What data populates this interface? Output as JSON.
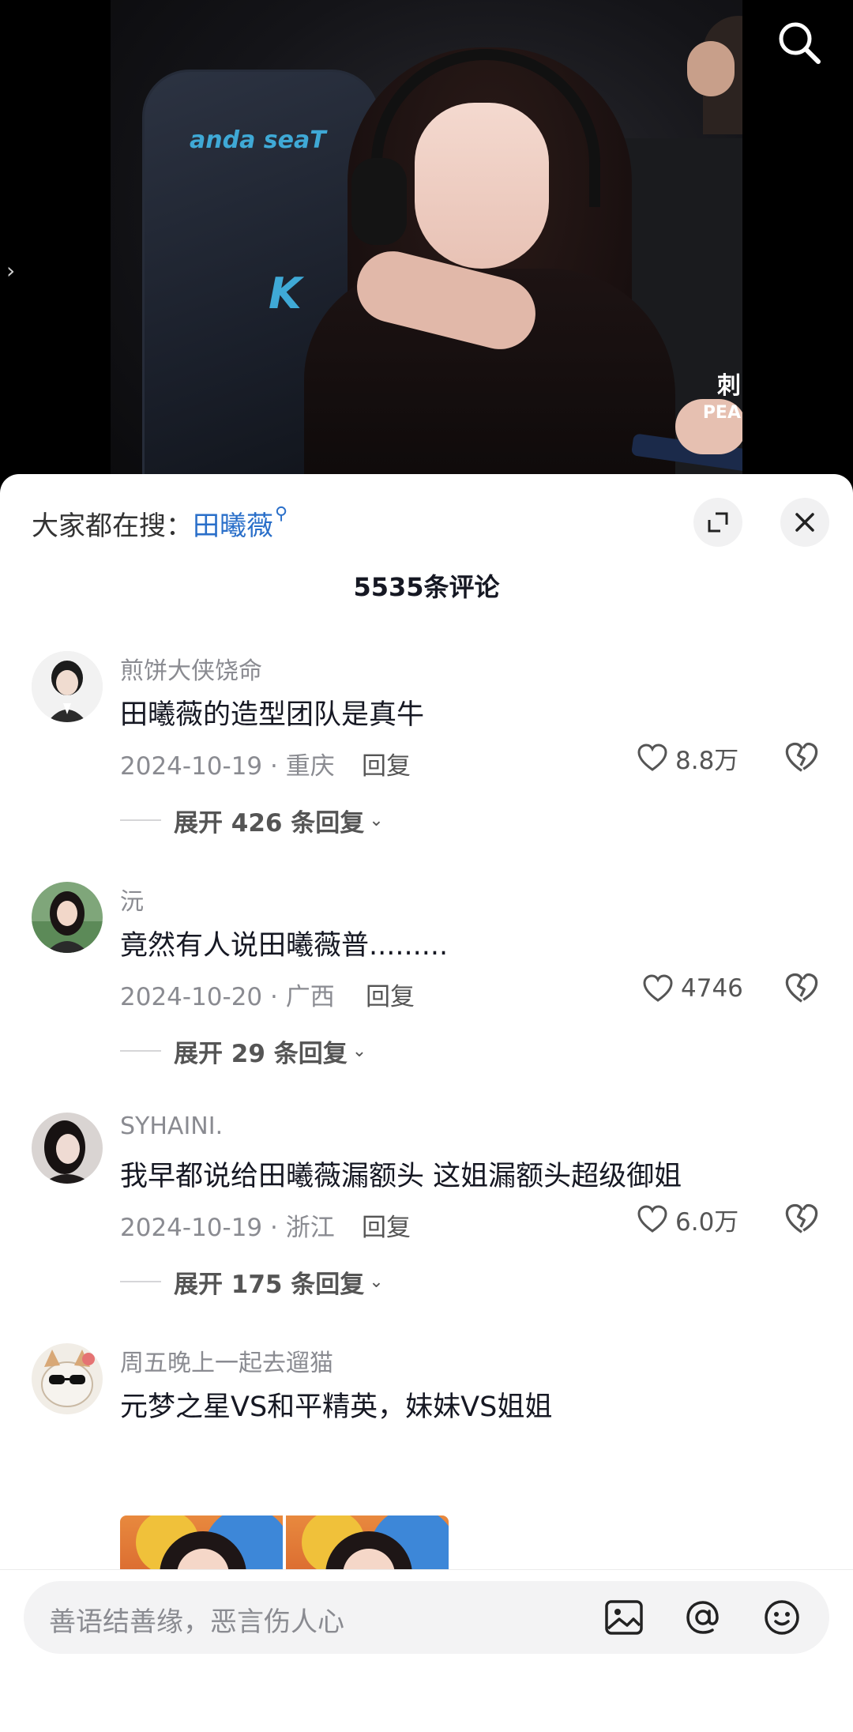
{
  "video": {
    "chair_brand": "anda seaT",
    "chair_logo": "K",
    "overlay_logo_line1": "刺",
    "overlay_logo_line2": "PEA"
  },
  "top_icons": {
    "search": "search-icon",
    "left_nav": "chevron-right-icon"
  },
  "sheet": {
    "hot_search_prefix": "大家都在搜：",
    "hot_search_term": "田曦薇",
    "comment_count": "5535条评论",
    "expand_icon": "expand-icon",
    "close_icon": "close-icon"
  },
  "comments": [
    {
      "user": "煎饼大侠饶命",
      "text": "田曦薇的造型团队是真牛",
      "meta": "2024-10-19 · 重庆",
      "reply": "回复",
      "likes": "8.8万",
      "expand": "展开 426 条回复"
    },
    {
      "user": "沅",
      "text": "竟然有人说田曦薇普.........",
      "meta": "2024-10-20 · 广西",
      "reply": "回复",
      "likes": "4746",
      "expand": "展开 29 条回复"
    },
    {
      "user": "SYHAINI.",
      "text": "我早都说给田曦薇漏额头 这姐漏额头超级御姐",
      "meta": "2024-10-19 · 浙江",
      "reply": "回复",
      "likes": "6.0万",
      "expand": "展开 175 条回复"
    },
    {
      "user": "周五晚上一起去遛猫",
      "text": "元梦之星VS和平精英，妹妹VS姐姐"
    }
  ],
  "input": {
    "placeholder": "善语结善缘，恶言伤人心",
    "icons": [
      "image-icon",
      "at-icon",
      "emoji-icon"
    ]
  }
}
